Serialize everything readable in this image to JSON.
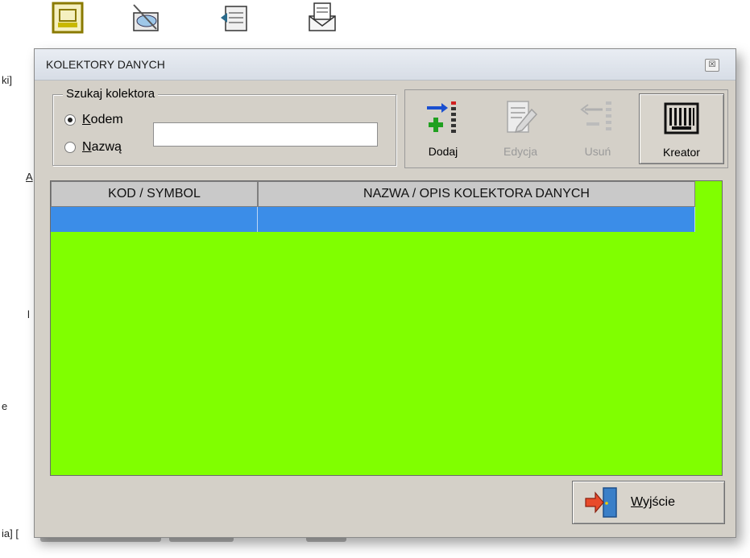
{
  "background_app": {
    "fragments": [
      "ki]",
      "A",
      "e",
      "ia] [",
      "l"
    ]
  },
  "dialog": {
    "title": "KOLEKTORY DANYCH",
    "close_glyph": "☒",
    "search_group": {
      "legend": "Szukaj kolektora",
      "options": [
        {
          "accel": "K",
          "rest": "odem",
          "checked": true
        },
        {
          "accel": "N",
          "rest": "azwą",
          "checked": false
        }
      ],
      "input_value": ""
    },
    "toolbar": [
      {
        "label": "Dodaj",
        "enabled": true,
        "icon": "add-list-icon"
      },
      {
        "label": "Edycja",
        "enabled": false,
        "icon": "edit-document-icon"
      },
      {
        "label": "Usuń",
        "enabled": false,
        "icon": "remove-list-icon"
      },
      {
        "label": "Kreator",
        "enabled": true,
        "icon": "barcode-icon"
      }
    ],
    "grid": {
      "columns": [
        "KOD / SYMBOL",
        "NAZWA / OPIS KOLEKTORA DANYCH"
      ],
      "rows": [
        [
          "",
          ""
        ]
      ],
      "background_color": "#80ff00",
      "selected_row_color": "#3b8de8"
    },
    "exit_button": {
      "accel": "W",
      "rest": "yjście",
      "icon": "exit-door-icon"
    }
  }
}
